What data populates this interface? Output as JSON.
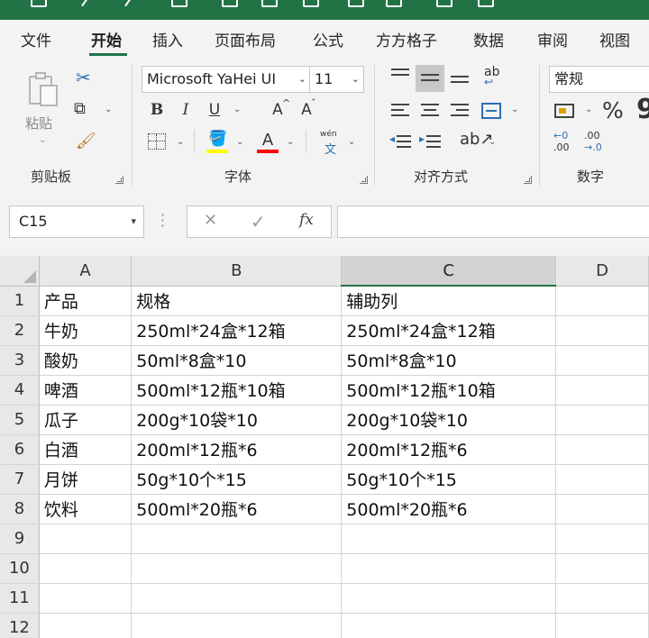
{
  "tabs": [
    {
      "label": "文件",
      "active": false
    },
    {
      "label": "开始",
      "active": true
    },
    {
      "label": "插入",
      "active": false
    },
    {
      "label": "页面布局",
      "active": false
    },
    {
      "label": "公式",
      "active": false
    },
    {
      "label": "方方格子",
      "active": false
    },
    {
      "label": "数据",
      "active": false
    },
    {
      "label": "审阅",
      "active": false
    },
    {
      "label": "视图",
      "active": false
    }
  ],
  "ribbon": {
    "clipboard": {
      "paste_label": "粘贴",
      "group_label": "剪贴板"
    },
    "font": {
      "font_name": "Microsoft YaHei UI",
      "font_size": "11",
      "bold": "B",
      "italic": "I",
      "underline": "U",
      "grow": "A",
      "shrink": "A",
      "font_color_letter": "A",
      "wen": "wén",
      "wen_char": "文",
      "fill_color": "#ffff00",
      "font_color": "#ff0000",
      "group_label": "字体"
    },
    "alignment": {
      "wrap_glyph": "ab",
      "group_label": "对齐方式"
    },
    "number": {
      "format": "常规",
      "percent": "%",
      "comma": "9",
      "inc_decimal_top": "←0",
      "inc_decimal_bottom": ".00",
      "dec_decimal_top": ".00",
      "dec_decimal_bottom": "→.0",
      "group_label": "数字"
    }
  },
  "formula_bar": {
    "name_box": "C15",
    "cancel_glyph": "✕",
    "enter_glyph": "✓",
    "fx": "fx",
    "formula": ""
  },
  "grid": {
    "columns": [
      "A",
      "B",
      "C",
      "D"
    ],
    "selected_column": "C",
    "rows": [
      {
        "n": "1",
        "cells": [
          "产品",
          "规格",
          "辅助列",
          ""
        ]
      },
      {
        "n": "2",
        "cells": [
          "牛奶",
          "250ml*24盒*12箱",
          "250ml*24盒*12箱",
          ""
        ]
      },
      {
        "n": "3",
        "cells": [
          "酸奶",
          "50ml*8盒*10",
          "50ml*8盒*10",
          ""
        ]
      },
      {
        "n": "4",
        "cells": [
          "啤酒",
          "500ml*12瓶*10箱",
          "500ml*12瓶*10箱",
          ""
        ]
      },
      {
        "n": "5",
        "cells": [
          "瓜子",
          "200g*10袋*10",
          "200g*10袋*10",
          ""
        ]
      },
      {
        "n": "6",
        "cells": [
          "白酒",
          "200ml*12瓶*6",
          "200ml*12瓶*6",
          ""
        ]
      },
      {
        "n": "7",
        "cells": [
          "月饼",
          "50g*10个*15",
          "50g*10个*15",
          ""
        ]
      },
      {
        "n": "8",
        "cells": [
          "饮料",
          "500ml*20瓶*6",
          "500ml*20瓶*6",
          ""
        ]
      },
      {
        "n": "9",
        "cells": [
          "",
          "",
          "",
          ""
        ]
      },
      {
        "n": "10",
        "cells": [
          "",
          "",
          "",
          ""
        ]
      },
      {
        "n": "11",
        "cells": [
          "",
          "",
          "",
          ""
        ]
      },
      {
        "n": "12",
        "cells": [
          "",
          "",
          "",
          ""
        ]
      }
    ]
  }
}
